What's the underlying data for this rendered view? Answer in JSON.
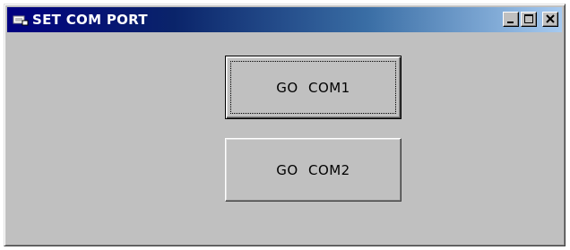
{
  "window": {
    "title": "SET COM PORT",
    "icon": "app-icon",
    "controls": {
      "minimize_icon": "minimize-icon",
      "maximize_icon": "maximize-icon",
      "close_icon": "close-icon"
    }
  },
  "main": {
    "buttons": [
      {
        "label": "GO   COM1",
        "focused": true
      },
      {
        "label": "GO   COM2",
        "focused": false
      }
    ]
  },
  "colors": {
    "titlebar_start": "#000080",
    "titlebar_end": "#a6caf0",
    "face": "#c0c0c0",
    "title_text": "#ffffff"
  }
}
